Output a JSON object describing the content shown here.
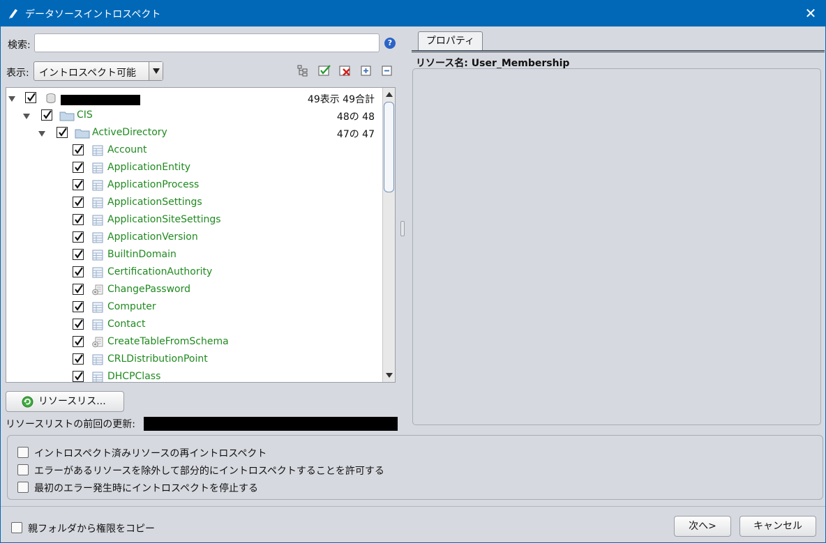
{
  "window": {
    "title": "データソースイントロスペクト"
  },
  "search": {
    "label": "検索:",
    "value": "",
    "placeholder": ""
  },
  "view": {
    "label": "表示:",
    "selected": "イントロスペクト可能"
  },
  "toolbar_icons": [
    "tree-icon",
    "check-all-icon",
    "uncheck-all-icon",
    "expand-all-icon",
    "collapse-all-icon"
  ],
  "tree": {
    "root": {
      "name": "",
      "count": "49表示 49合計"
    },
    "folder1": {
      "name": "CIS",
      "count": "48の 48"
    },
    "folder2": {
      "name": "ActiveDirectory",
      "count": "47の 47"
    },
    "items": [
      {
        "label": "Account",
        "icon": "table-icon"
      },
      {
        "label": "ApplicationEntity",
        "icon": "table-icon"
      },
      {
        "label": "ApplicationProcess",
        "icon": "table-icon"
      },
      {
        "label": "ApplicationSettings",
        "icon": "table-icon"
      },
      {
        "label": "ApplicationSiteSettings",
        "icon": "table-icon"
      },
      {
        "label": "ApplicationVersion",
        "icon": "table-icon"
      },
      {
        "label": "BuiltinDomain",
        "icon": "table-icon"
      },
      {
        "label": "CertificationAuthority",
        "icon": "table-icon"
      },
      {
        "label": "ChangePassword",
        "icon": "procedure-icon"
      },
      {
        "label": "Computer",
        "icon": "table-icon"
      },
      {
        "label": "Contact",
        "icon": "table-icon"
      },
      {
        "label": "CreateTableFromSchema",
        "icon": "procedure-icon"
      },
      {
        "label": "CRLDistributionPoint",
        "icon": "table-icon"
      },
      {
        "label": "DHCPClass",
        "icon": "table-icon"
      }
    ]
  },
  "resource_list_button": "リソースリス...",
  "last_update_label": "リソースリストの前回の更新:",
  "properties": {
    "tab": "プロパティ",
    "resource_name": "リソース名: User_Membership"
  },
  "options": [
    "イントロスペクト済みリソースの再イントロスペクト",
    "エラーがあるリソースを除外して部分的にイントロスペクトすることを許可する",
    "最初のエラー発生時にイントロスペクトを停止する"
  ],
  "copy_permissions": "親フォルダから権限をコピー",
  "buttons": {
    "next": "次へ>",
    "cancel": "キャンセル"
  },
  "colors": {
    "titlebar": "#0168b8",
    "tree_label": "#1f8a1f",
    "background": "#d6d9df"
  }
}
